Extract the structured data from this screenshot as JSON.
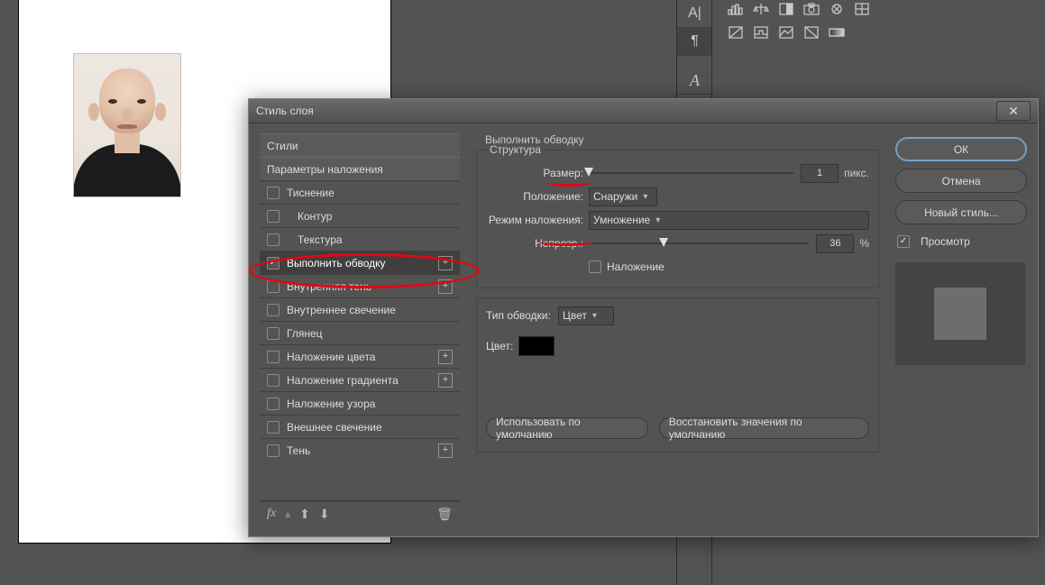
{
  "dialog": {
    "title": "Стиль слоя",
    "close": "✕",
    "effects": {
      "styles_header": "Стили",
      "blend_header": "Параметры наложения",
      "items": [
        {
          "label": "Тиснение"
        },
        {
          "label": "Контур"
        },
        {
          "label": "Текстура"
        },
        {
          "label": "Выполнить обводку"
        },
        {
          "label": "Внутренняя тень"
        },
        {
          "label": "Внутреннее свечение"
        },
        {
          "label": "Глянец"
        },
        {
          "label": "Наложение цвета"
        },
        {
          "label": "Наложение градиента"
        },
        {
          "label": "Наложение узора"
        },
        {
          "label": "Внешнее свечение"
        },
        {
          "label": "Тень"
        }
      ],
      "footer_fx": "fx"
    },
    "stroke": {
      "section": "Выполнить обводку",
      "structure": "Структура",
      "size_label": "Размер:",
      "size_value": "1",
      "size_unit": "пикс.",
      "position_label": "Положение:",
      "position_value": "Снаружи",
      "blend_label": "Режим наложения:",
      "blend_value": "Умножение",
      "opacity_label": "Непрозр.:",
      "opacity_value": "36",
      "opacity_unit": "%",
      "overlay_label": "Наложение",
      "stroketype_label": "Тип обводки:",
      "stroketype_value": "Цвет",
      "color_label": "Цвет:",
      "make_default": "Использовать по умолчанию",
      "reset_default": "Восстановить значения по умолчанию"
    },
    "actions": {
      "ok": "ОК",
      "cancel": "Отмена",
      "newstyle": "Новый стиль...",
      "preview": "Просмотр"
    }
  },
  "toolbar": {
    "vcell1": "A|",
    "vcell2": "¶",
    "vcell4": "A"
  }
}
